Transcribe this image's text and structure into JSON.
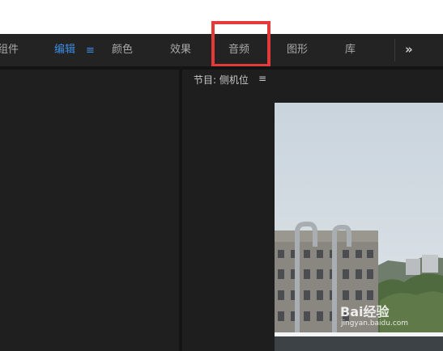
{
  "workspace_tabs": [
    {
      "label": "组件"
    },
    {
      "label": "编辑",
      "active": true
    },
    {
      "label": "颜色"
    },
    {
      "label": "效果"
    },
    {
      "label": "音频"
    },
    {
      "label": "图形"
    },
    {
      "label": "库"
    }
  ],
  "workspace_menu_glyph": "≡",
  "overflow_glyph": "»",
  "program_panel": {
    "title": "节目: 侧机位",
    "menu_glyph": "≡"
  },
  "watermark": {
    "brand": "Bai经验",
    "url": "jingyan.baidu.com"
  },
  "colors": {
    "active_tab": "#3b8ee6",
    "highlight_box": "#e53a3a"
  }
}
